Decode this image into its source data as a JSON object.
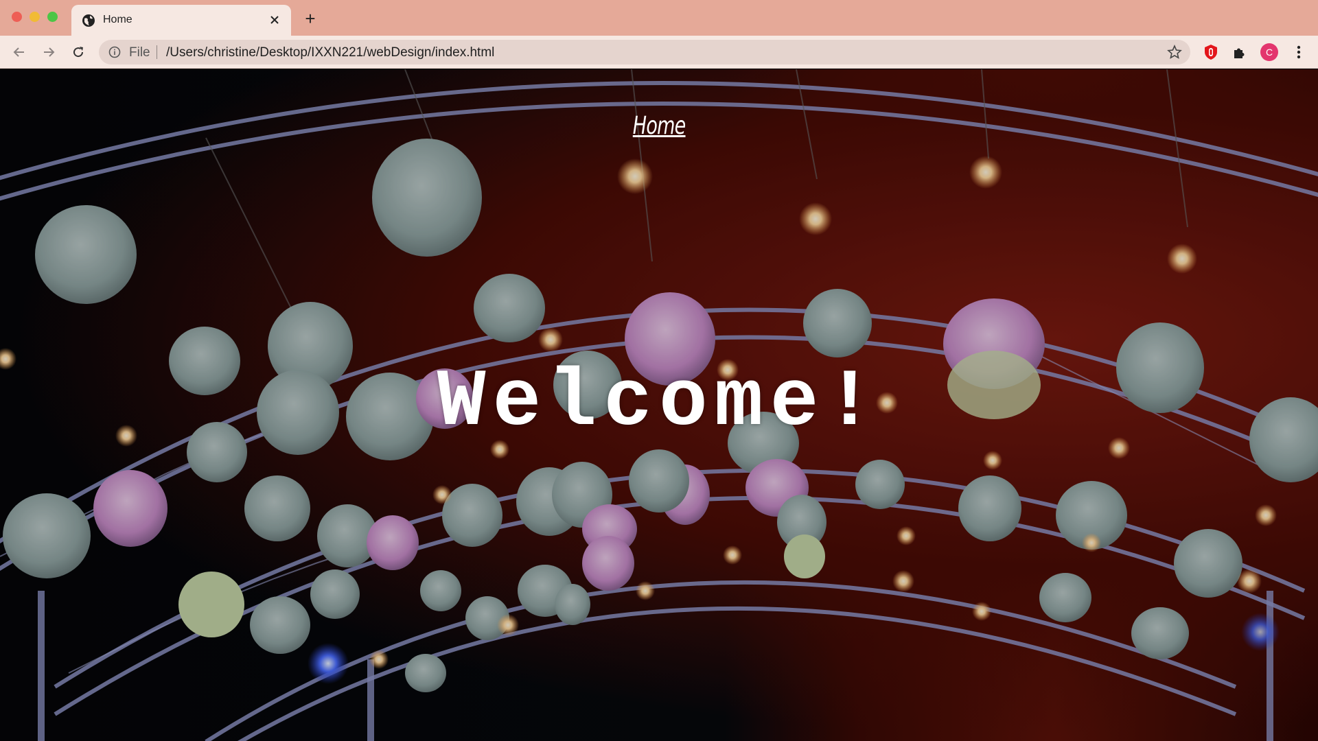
{
  "browser": {
    "tab": {
      "title": "Home",
      "favicon": "globe-icon",
      "close_icon": "close-icon"
    },
    "new_tab_label": "+",
    "omnibox": {
      "scheme_label": "File",
      "url": "/Users/christine/Desktop/IXXN221/webDesign/index.html"
    },
    "profile_initial": "C",
    "colors": {
      "titlebar": "#e5a998",
      "toolbar": "#f6e8e2",
      "omnibox": "#e5d4ce",
      "avatar": "#e3356d",
      "extension_badge": "#e3161b"
    }
  },
  "page": {
    "nav": {
      "home_label": "Home"
    },
    "hero": {
      "heading": "Welcome!",
      "background": "string lights and paper lanterns hanging from curved truss arches"
    }
  }
}
